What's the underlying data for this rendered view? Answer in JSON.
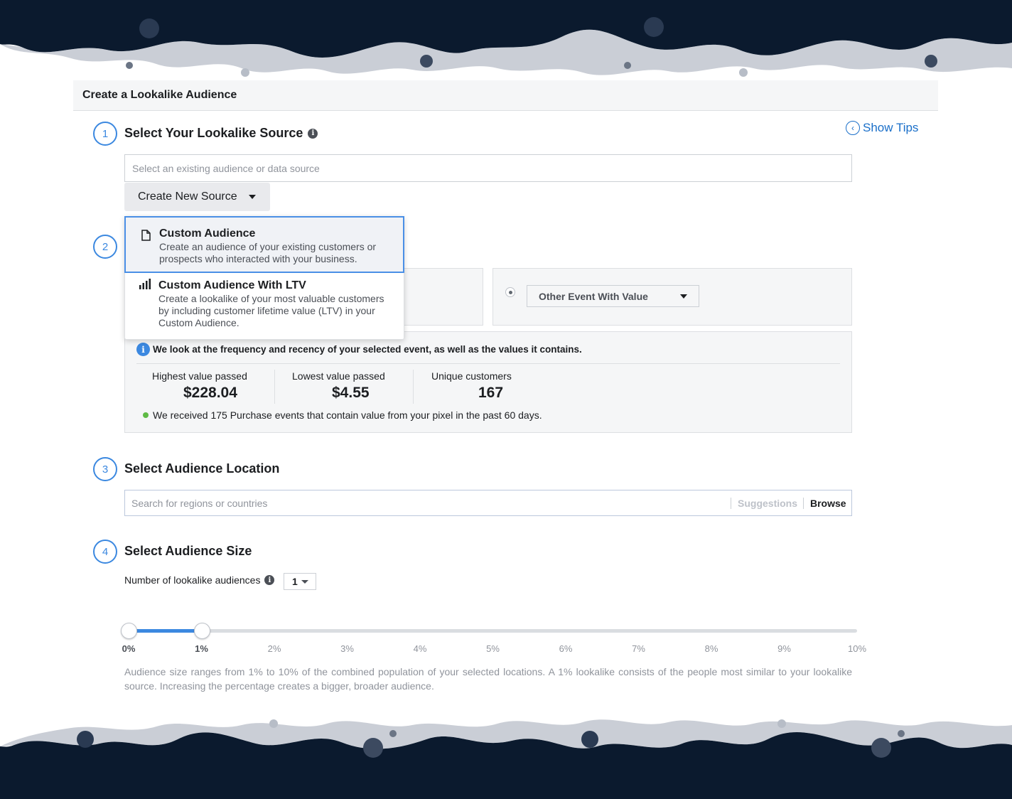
{
  "panel": {
    "title": "Create a Lookalike Audience"
  },
  "show_tips": {
    "label": "Show Tips"
  },
  "steps": {
    "source": {
      "number": "1",
      "title": "Select Your Lookalike Source",
      "placeholder": "Select an existing audience or data source",
      "create_button": "Create New Source"
    },
    "event": {
      "number": "2"
    },
    "location": {
      "number": "3",
      "title": "Select Audience Location",
      "placeholder": "Search for regions or countries",
      "suggestions": "Suggestions",
      "browse": "Browse"
    },
    "size": {
      "number": "4",
      "title": "Select Audience Size",
      "num_label": "Number of lookalike audiences",
      "num_value": "1",
      "description": "Audience size ranges from 1% to 10% of the combined population of your selected locations. A 1% lookalike consists of the people most similar to your lookalike source. Increasing the percentage creates a bigger, broader audience."
    }
  },
  "dropdown": {
    "items": [
      {
        "icon": "document-icon",
        "title": "Custom Audience",
        "description": "Create an audience of your existing customers or prospects who interacted with your business."
      },
      {
        "icon": "bar-chart-icon",
        "title": "Custom Audience With LTV",
        "description": "Create a lookalike of your most valuable customers by including customer lifetime value (LTV) in your Custom Audience."
      }
    ]
  },
  "event_select": {
    "value": "Other Event With Value"
  },
  "stats": {
    "note": "We look at the frequency and recency of your selected event, as well as the values it contains.",
    "items": [
      {
        "label": "Highest value passed",
        "value": "$228.04"
      },
      {
        "label": "Lowest value passed",
        "value": "$4.55"
      },
      {
        "label": "Unique customers",
        "value": "167"
      }
    ],
    "received": "We received 175 Purchase events that contain value from your pixel in the past 60 days."
  },
  "slider": {
    "range_start_percent": 0,
    "range_end_percent": 1,
    "ticks": [
      "0%",
      "1%",
      "2%",
      "3%",
      "4%",
      "5%",
      "6%",
      "7%",
      "8%",
      "9%",
      "10%"
    ]
  },
  "colors": {
    "accent": "#3b88e0",
    "frame": "#0b1a2e",
    "success": "#5fbb46"
  }
}
